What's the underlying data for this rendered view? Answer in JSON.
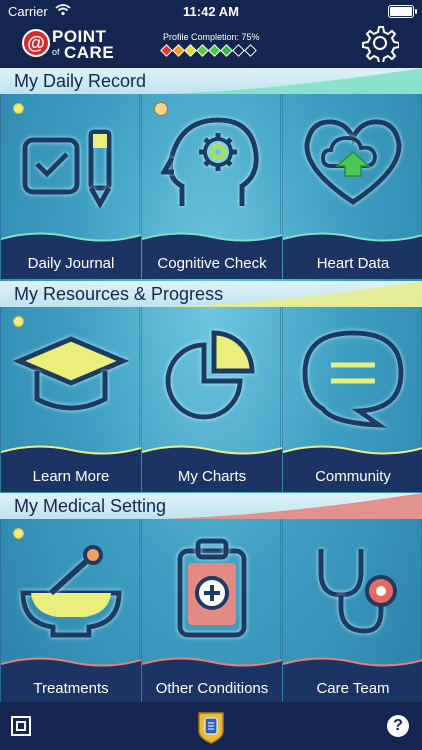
{
  "status_bar": {
    "carrier": "Carrier",
    "time": "11:42 AM"
  },
  "header": {
    "logo_line1": "POINT",
    "logo_of": "of",
    "logo_line2": "CARE",
    "logo_mark": "@",
    "profile_completion": "Profile Completion: 75%",
    "diamond_colors": [
      "#d93a3a",
      "#e8a22a",
      "#e0d83a",
      "#5fc24a",
      "#4cc24a",
      "#3fb84a",
      "#ffffff00",
      "#ffffff00"
    ],
    "settings_icon": "gear-icon"
  },
  "sections": [
    {
      "title": "My Daily Record",
      "swoosh_color": "#7fe0c6",
      "tiles": [
        {
          "label": "Daily Journal",
          "icon": "checkbox-pencil-icon",
          "dot": "small"
        },
        {
          "label": "Cognitive Check",
          "icon": "head-gear-icon",
          "dot": "big"
        },
        {
          "label": "Heart Data",
          "icon": "heart-cloud-icon",
          "dot": "none"
        }
      ]
    },
    {
      "title": "My Resources & Progress",
      "swoosh_color": "#e8ec8a",
      "tiles": [
        {
          "label": "Learn More",
          "icon": "graduation-cap-icon",
          "dot": "small"
        },
        {
          "label": "My Charts",
          "icon": "pie-chart-icon",
          "dot": "none"
        },
        {
          "label": "Community",
          "icon": "speech-bubble-icon",
          "dot": "none"
        }
      ]
    },
    {
      "title": "My Medical Setting",
      "swoosh_color": "#e6827c",
      "tiles": [
        {
          "label": "Treatments",
          "icon": "mortar-pestle-icon",
          "dot": "small"
        },
        {
          "label": "Other Conditions",
          "icon": "clipboard-plus-icon",
          "dot": "none"
        },
        {
          "label": "Care Team",
          "icon": "stethoscope-icon",
          "dot": "none"
        }
      ]
    }
  ],
  "bottom_bar": {
    "left_icon": "scan-square-icon",
    "center_icon": "badge-icon",
    "help_label": "?"
  },
  "colors": {
    "navy": "#14264f",
    "accent_yellow": "#f2ec7a",
    "icon_stroke": "#1f3a63",
    "icon_glow": "#bff3ff"
  }
}
